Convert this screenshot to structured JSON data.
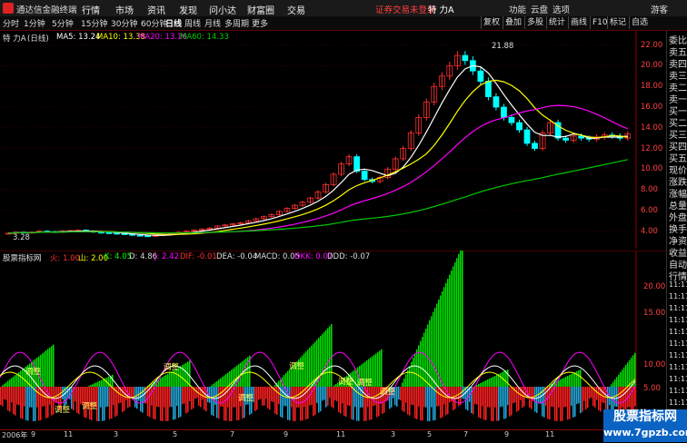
{
  "app": {
    "title": "通达信金融终端",
    "menu": [
      "行情",
      "市场",
      "资讯",
      "发现",
      "问小达",
      "财富圈",
      "交易"
    ],
    "warning": "证券交易未登录",
    "stock_label": "特 力A",
    "right_menu": [
      "功能",
      "云盘",
      "选项",
      "游客"
    ]
  },
  "periods": [
    "分时",
    "1分钟",
    "5分钟",
    "15分钟",
    "30分钟",
    "60分钟",
    "日线",
    "周线",
    "月线",
    "多周期",
    "更多"
  ],
  "active_period": "日线",
  "tools": [
    "复权",
    "叠加",
    "多股",
    "统计",
    "画线",
    "F10",
    "标记",
    "自选"
  ],
  "main_info": {
    "title": "特 力A",
    "period": "(日线)",
    "ma5": "MA5: 13.24",
    "ma10": "MA10: 13.38",
    "ma20": "MA20: 13.16",
    "ma60": "MA60: 14.33",
    "high_label": "21.88",
    "low_label": "3.28"
  },
  "main_axis": [
    "22.00",
    "20.00",
    "18.00",
    "16.00",
    "14.00",
    "12.00",
    "10.00",
    "8.00",
    "6.00",
    "4.00"
  ],
  "sub_info": {
    "title": "股票指标网",
    "huo": "火: 1.00",
    "shan": "山: 2.00",
    "k": "K: 4.05",
    "d": "D: 4.86",
    "j": "J: 2.42",
    "dif": "DIF: -0.01",
    "dea": "DEA: -0.04",
    "macd": "MACD: 0.05",
    "dkk": "DKK: 0.07",
    "ddd": "DDD: -0.07",
    "tag": "调整"
  },
  "sub_axis": [
    "20.00",
    "15.00",
    "10.00",
    "5.00"
  ],
  "right_panel": [
    "委比",
    "卖五",
    "卖四",
    "卖三",
    "卖二",
    "卖一",
    "买一",
    "买二",
    "买三",
    "买四",
    "买五",
    "现价",
    "涨跌",
    "涨幅",
    "总量",
    "外盘",
    "换手",
    "净资",
    "收益",
    "自动",
    "行情",
    "11:11",
    "11:11",
    "11:11",
    "11:11",
    "11:11",
    "11:11",
    "11:11",
    "11:11",
    "11:11",
    "11:11",
    "11:11"
  ],
  "xaxis": [
    "2006年",
    "9",
    "11",
    "3",
    "5",
    "7",
    "9",
    "11",
    "3",
    "5",
    "7",
    "9",
    "11"
  ],
  "watermark": {
    "line1": "股票指标网",
    "line2": "www.7gpzb.com"
  },
  "colors": {
    "up": "#ff3030",
    "down": "#00ffff",
    "ma5": "#ffffff",
    "ma10": "#ffff00",
    "ma20": "#ff00ff",
    "ma60": "#00cc00",
    "axis": "#8b0000"
  },
  "chart_data": {
    "type": "candlestick",
    "ylim": [
      3,
      22.5
    ],
    "close": [
      3.8,
      3.9,
      3.85,
      3.9,
      4.0,
      3.95,
      3.9,
      4.0,
      4.05,
      4.1,
      4.0,
      3.9,
      3.85,
      3.8,
      3.75,
      3.7,
      3.6,
      3.55,
      3.5,
      3.6,
      3.7,
      3.8,
      3.9,
      4.0,
      4.1,
      4.2,
      4.3,
      4.5,
      4.6,
      4.7,
      4.8,
      5.0,
      5.2,
      5.4,
      5.6,
      5.9,
      6.2,
      6.5,
      6.8,
      7.2,
      7.8,
      8.5,
      9.5,
      10.5,
      11.2,
      9.8,
      9.0,
      8.8,
      9.2,
      10.0,
      11.0,
      12.0,
      13.5,
      15.0,
      16.5,
      18.0,
      19.0,
      20.0,
      21.0,
      20.5,
      19.5,
      18.5,
      17.0,
      16.0,
      15.0,
      14.5,
      13.8,
      12.5,
      12.0,
      13.5,
      14.5,
      13.0,
      12.8,
      13.2,
      13.0,
      12.9,
      13.1,
      13.3,
      13.2,
      13.0,
      13.4
    ]
  }
}
